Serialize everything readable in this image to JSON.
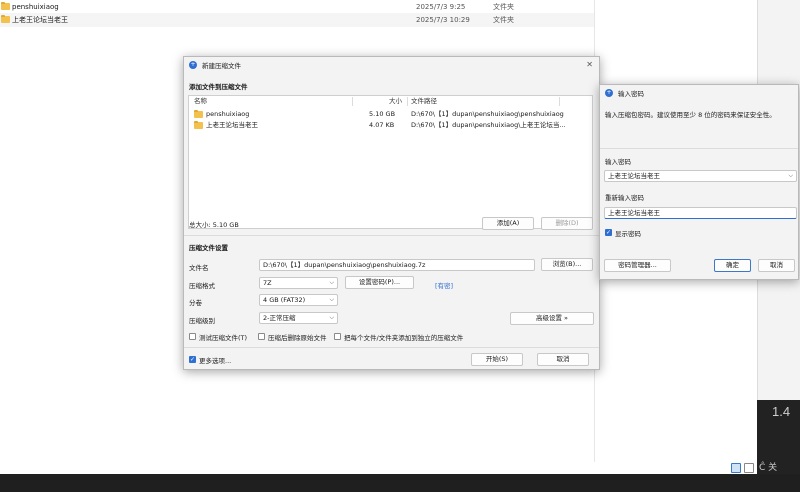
{
  "explorer": {
    "files": [
      {
        "name": "penshuixiaog",
        "date": "2025/7/3 9:25",
        "type": "文件夹"
      },
      {
        "name": "上老王论坛当老王",
        "date": "2025/7/3 10:29",
        "type": "文件夹"
      }
    ]
  },
  "archive_dialog": {
    "title": "新建压缩文件",
    "add_section": "添加文件到压缩文件",
    "columns": {
      "name": "名称",
      "size": "大小",
      "path": "文件路径"
    },
    "rows": [
      {
        "name": "penshuixiaog",
        "size": "5.10 GB",
        "path": "D:\\670\\【1】dupan\\penshuixiaog\\penshuixiaog"
      },
      {
        "name": "上老王论坛当老王",
        "size": "4.07 KB",
        "path": "D:\\670\\【1】dupan\\penshuixiaog\\上老王论坛当..."
      }
    ],
    "total_size": "总大小: 5.10 GB",
    "add_button": "添加(A)",
    "delete_button": "删除(D)",
    "settings_section": "压缩文件设置",
    "filename_label": "文件名",
    "filename_value": "D:\\670\\【1】dupan\\penshuixiaog\\penshuixiaog.7z",
    "browse_button": "浏览(B)...",
    "format_label": "压缩格式",
    "format_value": "7Z",
    "set_password_button": "设置密码(P)...",
    "encrypted_link": "[有密]",
    "volume_label": "分卷",
    "volume_value": "4 GB (FAT32)",
    "level_label": "压缩级别",
    "level_value": "2-正常压缩",
    "advanced_button": "高级设置 »",
    "option_test": "测试压缩文件(T)",
    "option_delete": "压缩后删除原始文件",
    "option_separate": "把每个文件/文件夹添加到独立的压缩文件",
    "more_options": "更多选项...",
    "start_button": "开始(S)",
    "cancel_button": "取消"
  },
  "password_dialog": {
    "title": "输入密码",
    "description": "输入压缩包密码。建议使用至少 8 位的密码来保证安全性。",
    "enter_label": "输入密码",
    "enter_value": "上老王论坛当老王",
    "reenter_label": "重新输入密码",
    "reenter_value": "上老王论坛当老王",
    "show_password": "显示密码",
    "manager_button": "密码管理器...",
    "ok_button": "确定",
    "cancel_button": "取消"
  },
  "background_right_text": "1.4",
  "background_right_text2": "Ĉ 关"
}
